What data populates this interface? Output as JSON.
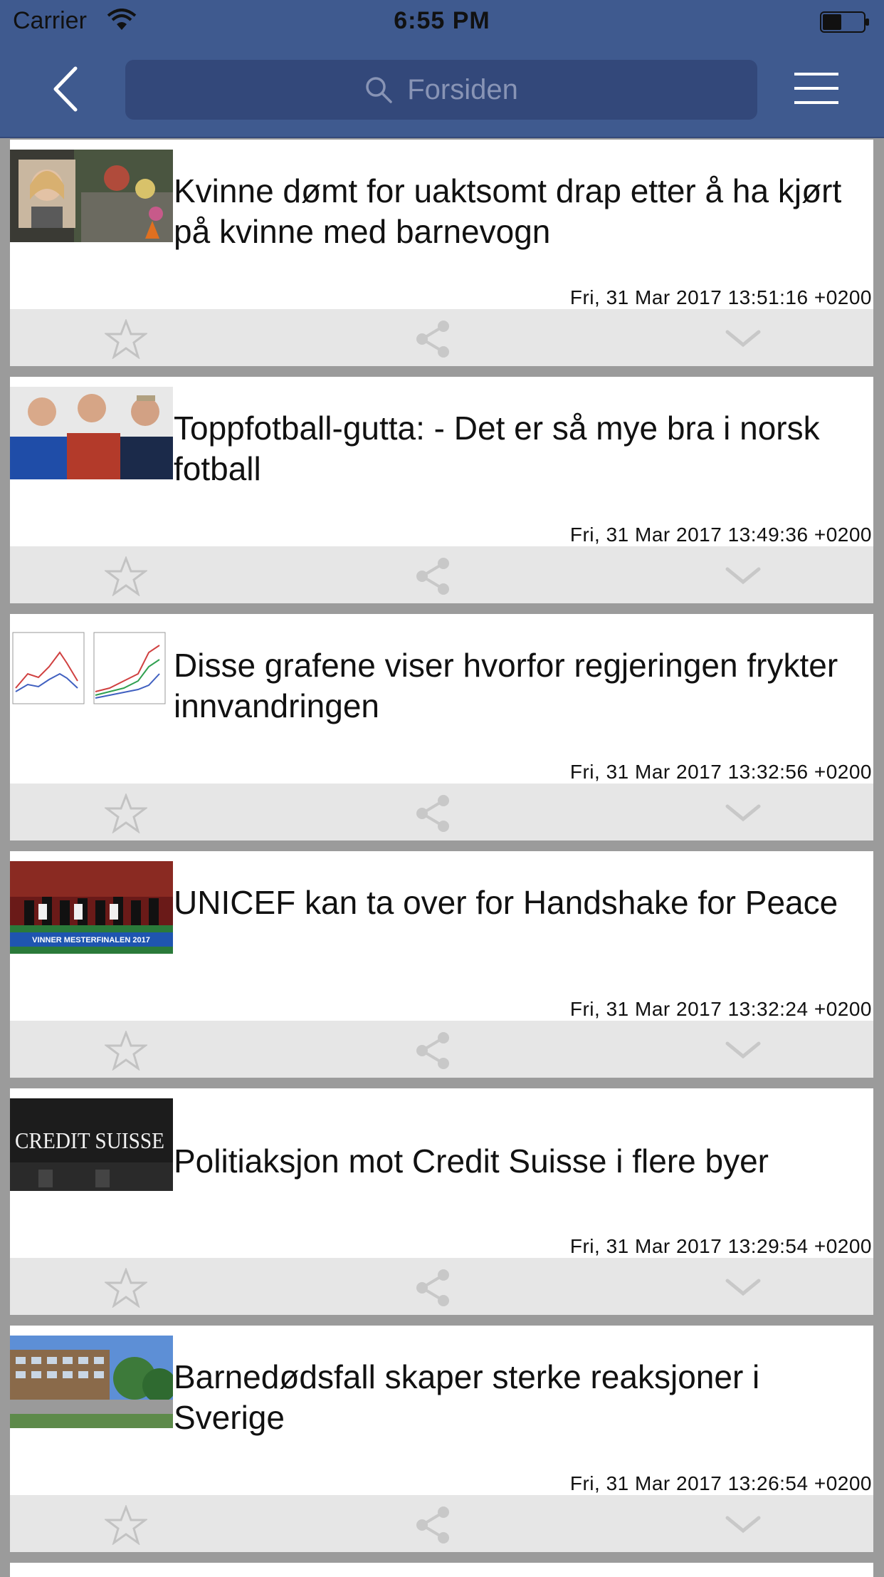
{
  "status_bar": {
    "carrier": "Carrier",
    "time": "6:55 PM"
  },
  "nav": {
    "search_placeholder": "Forsiden",
    "back_icon": "chevron-left-icon",
    "menu_icon": "hamburger-menu-icon"
  },
  "articles": [
    {
      "title": "Kvinne dømt for uaktsomt drap etter å ha kjørt på kvinne med barnevogn",
      "date": "Fri, 31 Mar 2017 13:51:16 +0200"
    },
    {
      "title": "Toppfotball-gutta: - Det er så mye bra i norsk fotball",
      "date": "Fri, 31 Mar 2017 13:49:36 +0200"
    },
    {
      "title": "Disse grafene viser hvorfor regjeringen frykter innvandringen",
      "date": "Fri, 31 Mar 2017 13:32:56 +0200"
    },
    {
      "title": "UNICEF kan ta over for Handshake for Peace",
      "date": "Fri, 31 Mar 2017 13:32:24 +0200"
    },
    {
      "title": "Politiaksjon mot Credit Suisse i flere byer",
      "date": "Fri, 31 Mar 2017 13:29:54 +0200"
    },
    {
      "title": "Barnedødsfall skaper sterke reaksjoner i Sverige",
      "date": "Fri, 31 Mar 2017 13:26:54 +0200"
    }
  ],
  "thumb_text": {
    "credit_suisse": "CREDIT SUISSE",
    "banner": "VINNER MESTERFINALEN 2017"
  },
  "colors": {
    "header": "#3f5a8f",
    "search_box": "#33487a",
    "action_bar": "#e6e6e6",
    "page_bg": "#9b9b9b"
  }
}
